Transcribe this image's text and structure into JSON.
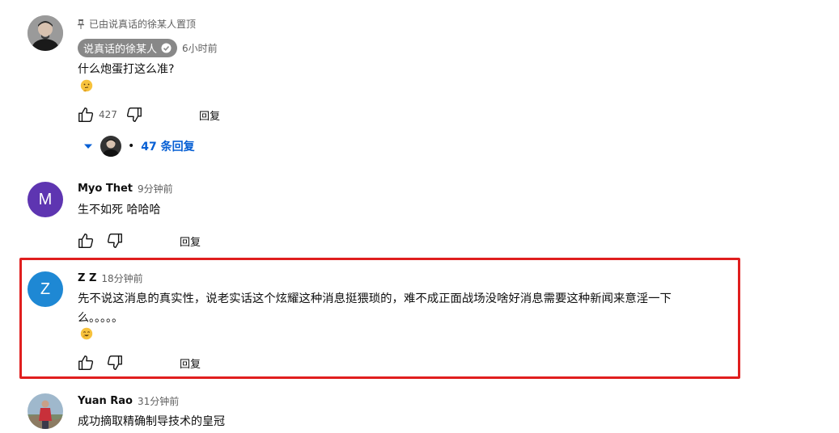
{
  "comments": [
    {
      "pinned_label": "已由说真话的徐某人置顶",
      "author": "说真话的徐某人",
      "time": "6小时前",
      "text_lines": [
        "什么炮蛋打这么准?"
      ],
      "emoji_icon": "thinking-face-emoji",
      "likes": "427",
      "reply_label": "回复",
      "replies_label": "47 条回复",
      "replies_dot": "•"
    },
    {
      "avatar_letter": "M",
      "avatar_color": "#5e35b1",
      "author": "Myo Thet",
      "time": "9分钟前",
      "text_lines": [
        "生不如死 哈哈哈"
      ],
      "reply_label": "回复"
    },
    {
      "avatar_letter": "Z",
      "avatar_color": "#1e88d4",
      "author": "Z Z",
      "time": "18分钟前",
      "text_lines": [
        "先不说这消息的真实性，说老实话这个炫耀这种消息挺猥琐的，难不成正面战场没啥好消息需要这种新闻来意淫一下",
        "么。。。。。"
      ],
      "emoji_icon": "grinning-emoji",
      "reply_label": "回复"
    },
    {
      "author": "Yuan Rao",
      "time": "31分钟前",
      "text_lines": [
        "成功摘取精确制导技术的皇冠"
      ]
    }
  ],
  "colors": {
    "highlight": "#e01e1e",
    "link_blue": "#065fd4",
    "secondary_text": "#606060"
  }
}
